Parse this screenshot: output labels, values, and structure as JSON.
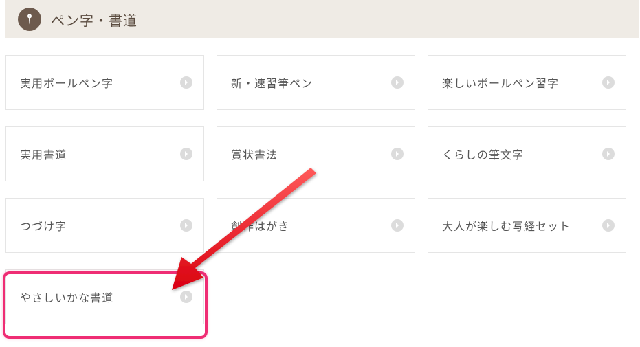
{
  "header": {
    "title": "ペン字・書道",
    "icon": "pen-nib-icon"
  },
  "cards": [
    {
      "label": "実用ボールペン字"
    },
    {
      "label": "新・速習筆ペン"
    },
    {
      "label": "楽しいボールペン習字"
    },
    {
      "label": "実用書道"
    },
    {
      "label": "賞状書法"
    },
    {
      "label": "くらしの筆文字"
    },
    {
      "label": "つづけ字"
    },
    {
      "label": "創作はがき"
    },
    {
      "label": "大人が楽しむ写経セット"
    },
    {
      "label": "やさしいかな書道"
    }
  ],
  "annotation": {
    "highlight_target_index": 9,
    "arrow": true,
    "highlight_color": "#ef2d74"
  }
}
